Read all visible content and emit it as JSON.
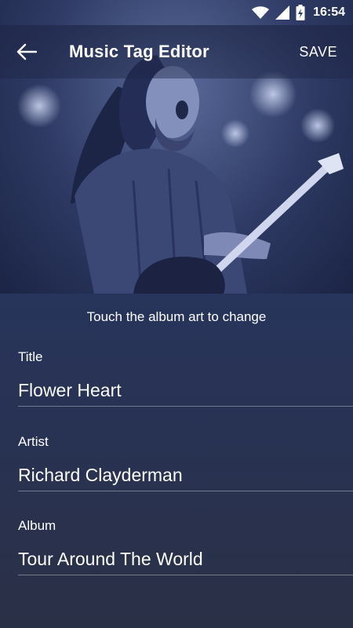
{
  "status_bar": {
    "time": "16:54",
    "icons": [
      "wifi-icon",
      "cell-signal-icon",
      "battery-charging-icon"
    ]
  },
  "app_bar": {
    "back_icon": "arrow-left-icon",
    "title": "Music Tag Editor",
    "save_label": "SAVE"
  },
  "album_art": {
    "hint": "Touch the album art to change"
  },
  "form": {
    "title": {
      "label": "Title",
      "value": "Flower Heart"
    },
    "artist": {
      "label": "Artist",
      "value": "Richard Clayderman"
    },
    "album": {
      "label": "Album",
      "value": "Tour Around The World"
    }
  },
  "colors": {
    "background": "#2a3556",
    "text": "#ffffff",
    "divider": "#7d849c"
  }
}
